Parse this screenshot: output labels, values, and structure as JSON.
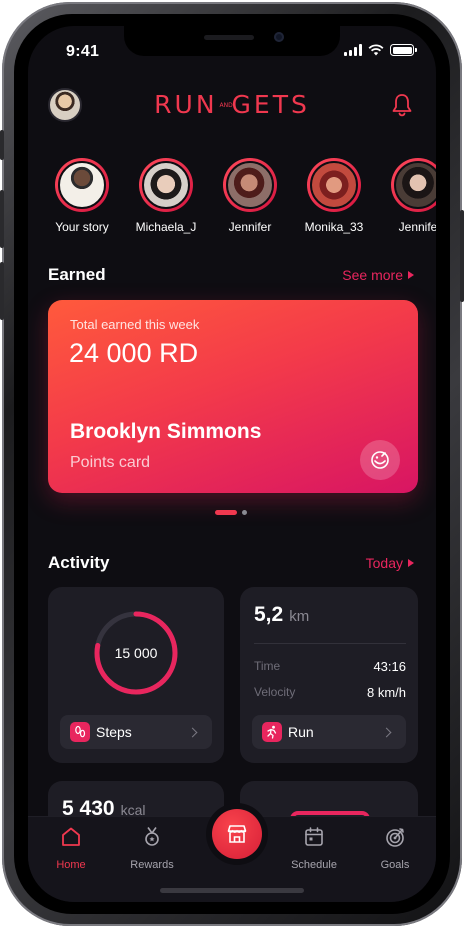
{
  "status_bar": {
    "time": "9:41"
  },
  "header": {
    "logo_left": "RUN",
    "logo_and": "AND",
    "logo_right": "GETS"
  },
  "stories": [
    {
      "name": "Your story",
      "color": "#b98c6e"
    },
    {
      "name": "Michaela_J",
      "color": "#d9b59c"
    },
    {
      "name": "Jennifer",
      "color": "#a45b4a"
    },
    {
      "name": "Monika_33",
      "color": "#c4594e"
    },
    {
      "name": "Jennife",
      "color": "#c9a38d"
    }
  ],
  "earned": {
    "title": "Earned",
    "see_more": "See more",
    "card": {
      "label": "Total earned this week",
      "amount": "24 000 RD",
      "name": "Brooklyn Simmons",
      "subtitle": "Points card"
    },
    "pager": {
      "pages": 2,
      "current": 1
    }
  },
  "activity": {
    "title": "Activity",
    "period": "Today",
    "steps": {
      "value": "15 000",
      "progress": 0.78,
      "button": "Steps"
    },
    "run": {
      "distance": "5,2",
      "unit": "km",
      "time_label": "Time",
      "time_value": "43:16",
      "velocity_label": "Velocity",
      "velocity_value": "8 km/h",
      "button": "Run"
    },
    "calories": {
      "value": "5 430",
      "unit": "kcal"
    }
  },
  "tabs": [
    {
      "label": "Home",
      "icon": "home-icon",
      "active": true
    },
    {
      "label": "Rewards",
      "icon": "medal-icon",
      "active": false
    },
    {
      "label": "Schedule",
      "icon": "calendar-icon",
      "active": false
    },
    {
      "label": "Goals",
      "icon": "target-icon",
      "active": false
    }
  ],
  "colors": {
    "accent": "#f0384f",
    "accent_pink": "#e8265e",
    "background": "#0e0d12",
    "card": "#1e1d25"
  }
}
